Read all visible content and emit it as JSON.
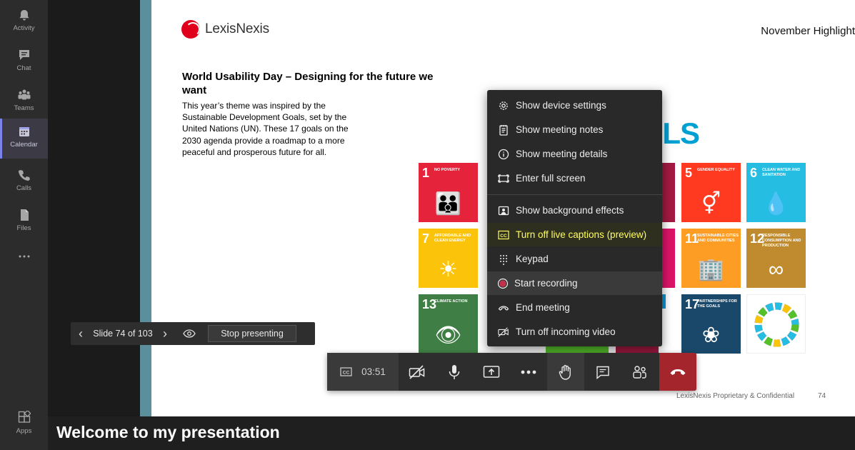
{
  "rail": {
    "items": [
      {
        "label": "Activity",
        "icon": "bell-icon"
      },
      {
        "label": "Chat",
        "icon": "chat-icon"
      },
      {
        "label": "Teams",
        "icon": "teams-icon"
      },
      {
        "label": "Calendar",
        "icon": "calendar-icon",
        "active": true
      },
      {
        "label": "Calls",
        "icon": "phone-icon"
      },
      {
        "label": "Files",
        "icon": "file-icon"
      },
      {
        "label": "",
        "icon": "more-icon"
      }
    ],
    "apps_label": "Apps"
  },
  "slide": {
    "logo_text": "LexisNexis",
    "top_right": "November Highlight",
    "title": "World Usability Day – Designing for the future we want",
    "body": "This year’s theme was inspired by the Sustainable Development Goals, set by the United Nations (UN). These 17 goals on the 2030 agenda provide a roadmap to a more peaceful and prosperous future for all.",
    "goals_word": "ALS",
    "footer": "LexisNexis Proprietary & Confidential",
    "page_number": "74",
    "tiles": [
      {
        "num": "1",
        "name": "NO POVERTY",
        "color": "#e5243b",
        "glyph": "👪"
      },
      {
        "num": "5",
        "name": "GENDER EQUALITY",
        "color": "#ff3a21",
        "glyph": "⚥"
      },
      {
        "num": "6",
        "name": "CLEAN WATER AND SANITATION",
        "color": "#26bde2",
        "glyph": "💧"
      },
      {
        "num": "7",
        "name": "AFFORDABLE AND CLEAN ENERGY",
        "color": "#fcc30b",
        "glyph": "☀"
      },
      {
        "num": "11",
        "name": "SUSTAINABLE CITIES AND COMMUNITIES",
        "color": "#fd9d24",
        "glyph": "🏢"
      },
      {
        "num": "12",
        "name": "RESPONSIBLE CONSUMPTION AND PRODUCTION",
        "color": "#bf8b2e",
        "glyph": "∞"
      },
      {
        "num": "13",
        "name": "CLIMATE ACTION",
        "color": "#3f7e44",
        "glyph": "👁"
      },
      {
        "num": "17",
        "name": "PARTNERSHIPS FOR THE GOALS",
        "color": "#19486a",
        "glyph": "❀"
      },
      {
        "num": "",
        "name": "",
        "color": "#ffffff",
        "glyph": "◎"
      }
    ],
    "partial_colors": [
      "#a21942",
      "#dd1367",
      "#0a97d9",
      "#56c02b"
    ]
  },
  "slide_nav": {
    "prev": "‹",
    "count": "Slide 74 of 103",
    "next": "›",
    "stop": "Stop presenting"
  },
  "menu": {
    "items": [
      {
        "label": "Show device settings",
        "icon": "gear-icon"
      },
      {
        "label": "Show meeting notes",
        "icon": "notes-icon"
      },
      {
        "label": "Show meeting details",
        "icon": "info-icon"
      },
      {
        "label": "Enter full screen",
        "icon": "fullscreen-icon"
      },
      {
        "label": "Show background effects",
        "icon": "background-effects-icon"
      },
      {
        "label": "Turn off live captions (preview)",
        "icon": "cc-icon",
        "highlighted": true
      },
      {
        "label": "Keypad",
        "icon": "keypad-icon"
      },
      {
        "label": "Start recording",
        "icon": "record-icon"
      },
      {
        "label": "End meeting",
        "icon": "end-call-icon"
      },
      {
        "label": "Turn off incoming video",
        "icon": "video-off-icon"
      }
    ]
  },
  "callbar": {
    "timer": "03:51",
    "buttons": [
      "camera-off-icon",
      "mic-icon",
      "share-icon",
      "more-icon",
      "raise-hand-icon",
      "chat-icon",
      "participants-icon"
    ],
    "hangup": "hangup-icon"
  },
  "caption": {
    "text": "Welcome to my presentation"
  },
  "colors": {
    "accent": "#7b83eb",
    "caption_highlight": "#ffff5e",
    "hangup": "#a4262c",
    "teal_strip": "#5b8f9c"
  }
}
